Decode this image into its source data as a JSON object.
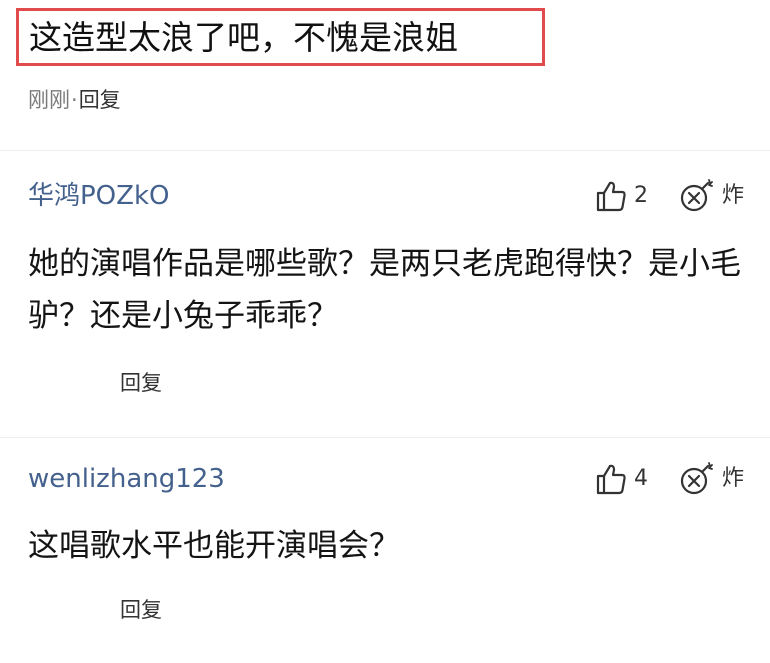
{
  "top_comment": {
    "text": "这造型太浪了吧，不愧是浪姐",
    "time": "刚刚",
    "separator": "·",
    "reply_label": "回复",
    "highlight_color": "#e24b4b"
  },
  "comments": [
    {
      "username": "华鸿POZkO",
      "likes": "2",
      "bomb_label": "炸",
      "text": "她的演唱作品是哪些歌？是两只老虎跑得快？是小毛驴？还是小兔子乖乖？",
      "reply_label": "回复"
    },
    {
      "username": "wenlizhang123",
      "likes": "4",
      "bomb_label": "炸",
      "text": "这唱歌水平也能开演唱会？",
      "reply_label": "回复"
    }
  ],
  "colors": {
    "username": "#44618d",
    "text": "#141414",
    "meta": "#7a7a7a"
  },
  "icons": {
    "like": "thumbs-up-icon",
    "bomb": "bomb-icon"
  }
}
